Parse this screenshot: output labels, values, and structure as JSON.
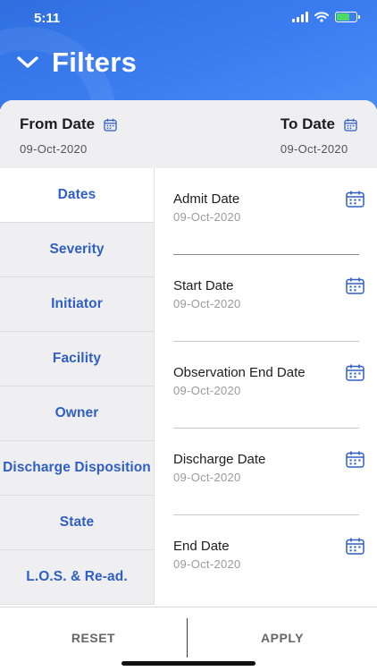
{
  "status_bar": {
    "time": "5:11",
    "battery_color": "#4cd964"
  },
  "header": {
    "title": "Filters",
    "collapse_icon": "chevron-down-icon",
    "accent": "#3b7df0"
  },
  "range": {
    "from_label": "From Date",
    "from_value": "09-Oct-2020",
    "to_label": "To Date",
    "to_value": "09-Oct-2020"
  },
  "sidebar": {
    "items": [
      {
        "label": "Dates",
        "active": true
      },
      {
        "label": "Severity"
      },
      {
        "label": "Initiator"
      },
      {
        "label": "Facility"
      },
      {
        "label": "Owner"
      },
      {
        "label": "Discharge Disposition"
      },
      {
        "label": "State"
      },
      {
        "label": "L.O.S. & Re-ad."
      }
    ],
    "text_color": "#2f5fc4"
  },
  "fields": [
    {
      "label": "Admit Date",
      "value": "09-Oct-2020"
    },
    {
      "label": "Start Date",
      "value": "09-Oct-2020"
    },
    {
      "label": "Observation End Date",
      "value": "09-Oct-2020"
    },
    {
      "label": "Discharge Date",
      "value": "09-Oct-2020"
    },
    {
      "label": "End Date",
      "value": "09-Oct-2020"
    }
  ],
  "footer": {
    "reset_label": "RESET",
    "apply_label": "APPLY"
  }
}
